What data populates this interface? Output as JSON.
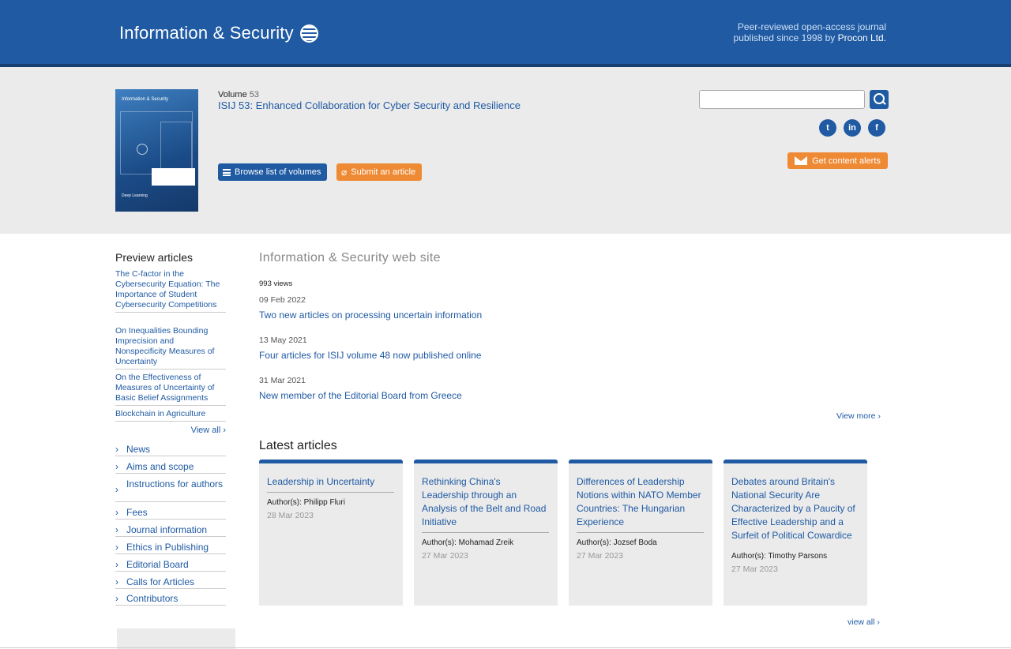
{
  "header": {
    "brand": "Information & Security",
    "tagline_prefix": "Peer-reviewed open-access journal published since 1998 by ",
    "publisher": "Procon Ltd."
  },
  "volume": {
    "label": "Volume",
    "number": "53",
    "title": "ISIJ 53: Enhanced Collaboration for Cyber Security and Resilience",
    "cover_title": "Information & Security",
    "cover_footer": "Deep Learning"
  },
  "actions": {
    "browse_label": "Browse list of volumes",
    "submit_label": "Submit an article",
    "alerts_label": "Get content alerts"
  },
  "search": {
    "placeholder": ""
  },
  "social": {
    "twitter": "t",
    "linkedin": "in",
    "facebook": "f"
  },
  "sidebar": {
    "preview_heading": "Preview articles",
    "preview_items": [
      "The C-factor in the Cybersecurity Equation: The Importance of Student Cybersecurity Competitions",
      "On Inequalities Bounding Imprecision and Nonspecificity Measures of Uncertainty",
      "On the Effectiveness of Measures of Uncertainty of Basic Belief Assignments",
      "Blockchain in Agriculture"
    ],
    "view_all": "View all ›",
    "nav": [
      "News",
      "Aims and scope",
      "Instructions for authors",
      "Fees",
      "Journal information",
      "Ethics in Publishing",
      "Editorial Board",
      "Calls for Articles",
      "Contributors"
    ]
  },
  "main": {
    "site_heading": "Information & Security web site",
    "views": "993 views",
    "news": [
      {
        "date": "09 Feb 2022",
        "title": "Two new articles on processing uncertain information"
      },
      {
        "date": "13 May 2021",
        "title": "Four articles for ISIJ volume 48 now published online"
      },
      {
        "date": "31 Mar 2021",
        "title": "New member of the Editorial Board from Greece"
      }
    ],
    "view_more": "View more ›",
    "latest_heading": "Latest articles",
    "articles": [
      {
        "title": "Leadership in Uncertainty",
        "author": "Author(s): Philipp Fluri",
        "date": "28 Mar 2023"
      },
      {
        "title": "Rethinking China's Leadership through an Analysis of the Belt and Road Initiative",
        "author": "Author(s): Mohamad Zreik",
        "date": "27 Mar 2023"
      },
      {
        "title": "Differences of Leadership Notions within NATO Member Countries: The Hungarian Experience",
        "author": "Author(s): Jozsef Boda",
        "date": "27 Mar 2023"
      },
      {
        "title": "Debates around Britain's National Security Are Characterized by a Paucity of Effective Leadership and a Surfeit of Political Cowardice",
        "author": "Author(s): Timothy Parsons",
        "date": "27 Mar 2023"
      }
    ],
    "view_all": "view all ›"
  },
  "colors": {
    "primary": "#1f5aa3",
    "accent": "#ef8a34",
    "band": "#ebebeb"
  }
}
